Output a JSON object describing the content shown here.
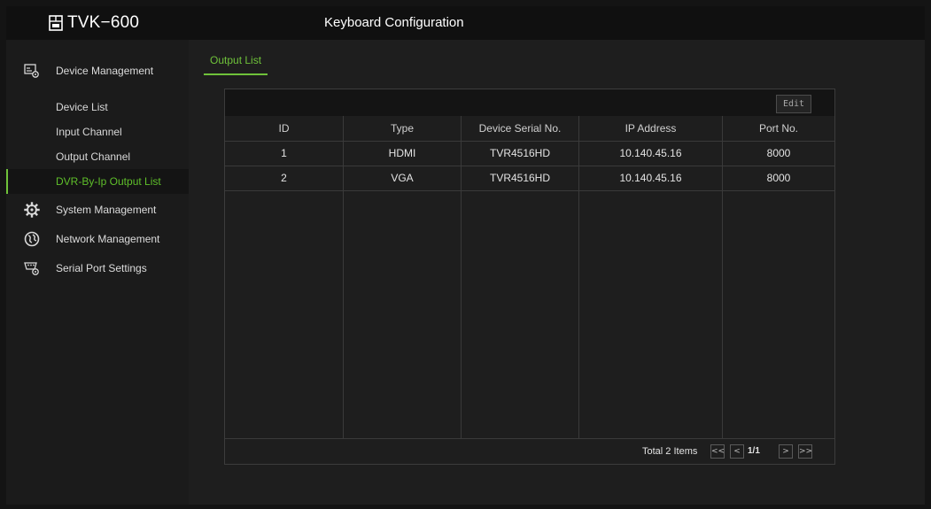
{
  "header": {
    "brand": "TVK−600",
    "title": "Keyboard Configuration"
  },
  "sidebar": {
    "groups": [
      {
        "label": "Device Management",
        "icon": "device-management-icon",
        "items": [
          {
            "label": "Device List",
            "active": false
          },
          {
            "label": "Input Channel",
            "active": false
          },
          {
            "label": "Output Channel",
            "active": false
          },
          {
            "label": "DVR-By-Ip Output List",
            "active": true
          }
        ]
      },
      {
        "label": "System Management",
        "icon": "gear-icon"
      },
      {
        "label": "Network Management",
        "icon": "globe-icon"
      },
      {
        "label": "Serial Port Settings",
        "icon": "serial-port-icon"
      }
    ]
  },
  "main": {
    "tab": "Output List",
    "edit_label": "Edit",
    "table": {
      "columns": [
        "ID",
        "Type",
        "Device Serial No.",
        "IP Address",
        "Port No."
      ],
      "rows": [
        [
          "1",
          "HDMI",
          "TVR4516HD",
          "10.140.45.16",
          "8000"
        ],
        [
          "2",
          "VGA",
          "TVR4516HD",
          "10.140.45.16",
          "8000"
        ]
      ]
    },
    "pagination": {
      "total": "Total 2 Items",
      "page": "1/1",
      "first": "<<",
      "prev": "<",
      "next": ">",
      "last": ">>"
    }
  },
  "colors": {
    "accent": "#6fc23a",
    "background": "#1e1e1e",
    "topbar": "#101010"
  }
}
